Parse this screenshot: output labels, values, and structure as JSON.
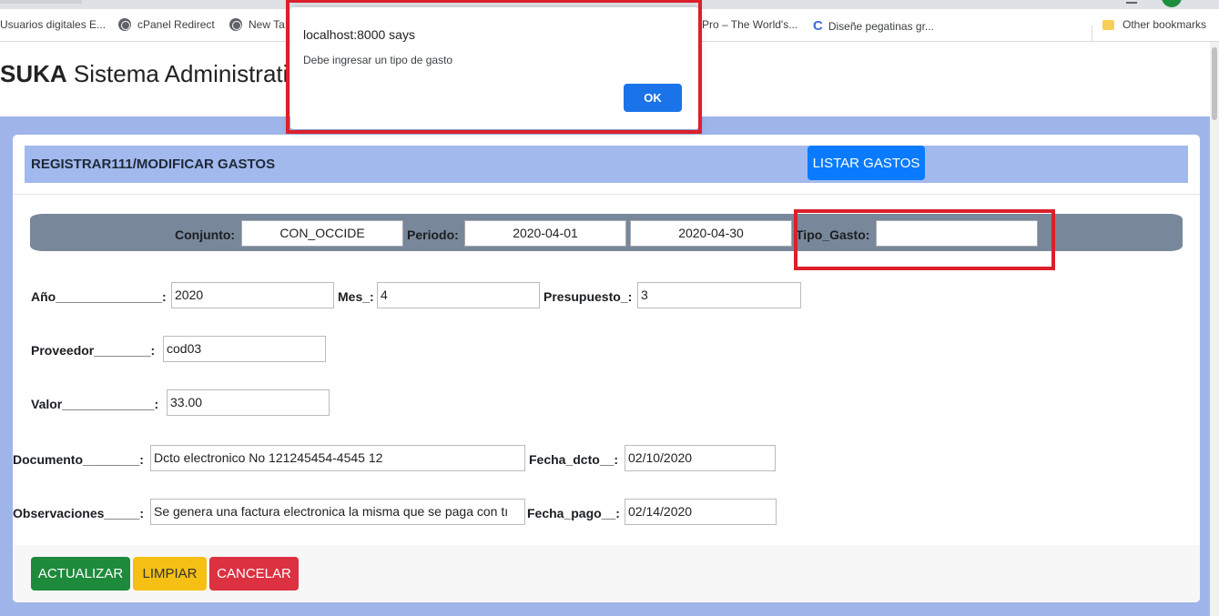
{
  "browser": {
    "bookmarks": [
      {
        "label": "Usuarios digitales E...",
        "icon": "none"
      },
      {
        "label": "cPanel Redirect",
        "icon": "globe-icon"
      },
      {
        "label": "New Ta",
        "icon": "globe-icon"
      },
      {
        "label": "xPro – The World's...",
        "icon": "none"
      },
      {
        "label": "Diseñe pegatinas gr...",
        "icon": "c-logo-icon"
      }
    ],
    "other_bookmarks": "Other bookmarks"
  },
  "app": {
    "brand": "SUKA",
    "title_rest": "Sistema Administrati"
  },
  "dialog": {
    "title": "localhost:8000 says",
    "message": "Debe ingresar un tipo de gasto",
    "ok_label": "OK"
  },
  "card": {
    "title": "REGISTRAR111/MODIFICAR GASTOS",
    "list_button": "LISTAR GASTOS"
  },
  "filters": {
    "conjunto_label": "Conjunto:",
    "conjunto_value": "CON_OCCIDE",
    "periodo_label": "Periodo:",
    "periodo_start": "2020-04-01",
    "periodo_end": "2020-04-30",
    "tipo_label": "Tipo_Gasto:",
    "tipo_value": ""
  },
  "form": {
    "anio_label": "Año_______________:",
    "anio_value": "2020",
    "mes_label": "Mes_:",
    "mes_value": "4",
    "presupuesto_label": "Presupuesto_:",
    "presupuesto_value": "3",
    "proveedor_label": "Proveedor________:",
    "proveedor_value": "cod03",
    "valor_label": "Valor_____________:",
    "valor_value": "33.00",
    "documento_label": "Documento________:",
    "documento_value": "Dcto electronico No 121245454-4545 12",
    "fecha_dcto_label": "Fecha_dcto__:",
    "fecha_dcto_value": "02/10/2020",
    "observaciones_label": "Observaciones_____:",
    "observaciones_value": "Se genera una factura electronica la misma que se paga con tı",
    "fecha_pago_label": "Fecha_pago__:",
    "fecha_pago_value": "02/14/2020"
  },
  "actions": {
    "update": "ACTUALIZAR",
    "clear": "LIMPIAR",
    "cancel": "CANCELAR"
  },
  "colors": {
    "page_background": "#9fb5ea",
    "header_band": "#a2b9ee",
    "filter_bar": "#79879a",
    "primary": "#0a7bff",
    "success": "#1e8a3b",
    "warning": "#f5c013",
    "danger": "#dc3141",
    "highlight_box": "#dc1f2b"
  }
}
